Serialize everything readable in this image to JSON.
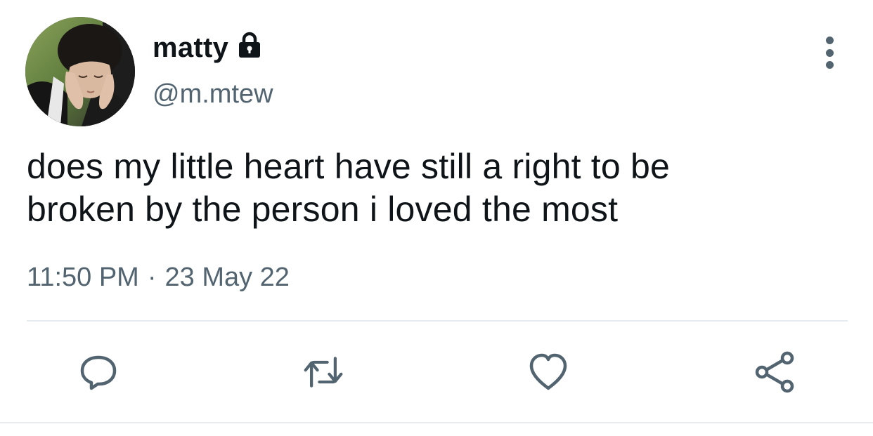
{
  "author": {
    "display_name": "matty",
    "handle": "@m.mtew",
    "protected_icon": "lock-icon",
    "avatar_icon": "profile-photo"
  },
  "tweet": {
    "text_line_1": "does my little heart have still a right to be",
    "text_line_2": "broken by the person i loved the most",
    "time": "11:50 PM",
    "separator": "·",
    "date": "23 May 22"
  },
  "actions": [
    {
      "name": "reply",
      "icon": "speech-bubble-icon"
    },
    {
      "name": "retweet",
      "icon": "retweet-icon"
    },
    {
      "name": "like",
      "icon": "heart-icon"
    },
    {
      "name": "share",
      "icon": "share-icon"
    }
  ],
  "menu": {
    "icon": "more-vertical-icon"
  },
  "colors": {
    "text_primary": "#0f1419",
    "text_secondary": "#536471",
    "divider": "#e6ecf0"
  }
}
